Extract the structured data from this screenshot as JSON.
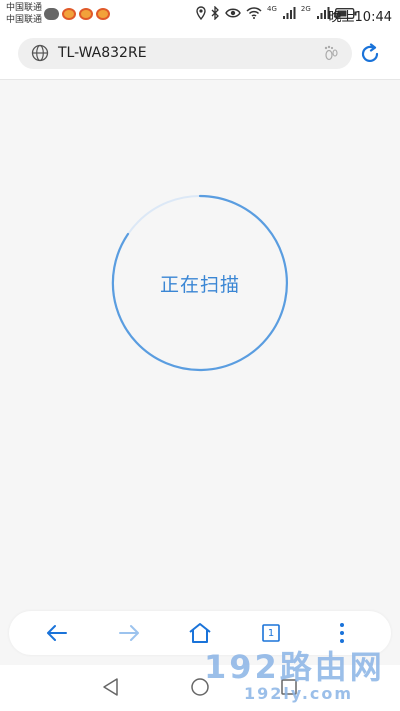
{
  "status_bar": {
    "carrier_1": "中国联通",
    "carrier_2": "中国联通",
    "network_1": "4G",
    "network_2": "2G",
    "time": "晚上10:44",
    "icons": [
      "wechat-icon",
      "weibo-icon",
      "location-icon",
      "bluetooth-icon",
      "eye-icon",
      "wifi-icon",
      "signal-icon",
      "battery-icon"
    ]
  },
  "address_bar": {
    "url": "TL-WA832RE",
    "icons": [
      "globe-icon",
      "footprint-icon",
      "refresh-icon"
    ]
  },
  "main": {
    "status_text": "正在扫描"
  },
  "toolbar": {
    "tab_count": "1",
    "icons": [
      "back-arrow-icon",
      "forward-arrow-icon",
      "home-icon",
      "tabs-icon",
      "more-icon"
    ]
  },
  "watermark": {
    "title": "192路由网",
    "domain": "192ly.com"
  },
  "colors": {
    "accent": "#1a73d9",
    "scan_text": "#3a86d4",
    "background": "#f6f6f6"
  }
}
